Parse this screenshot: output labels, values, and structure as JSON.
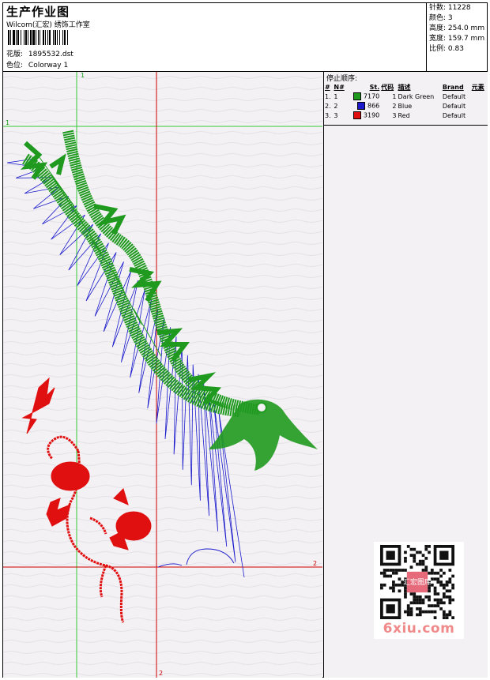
{
  "header": {
    "title": "生产作业图",
    "subtitle": "Wilcom(汇宏) 绣饰工作室",
    "design_label": "花版:",
    "design_value": "1895532.dst",
    "colorway_label": "色位:",
    "colorway_value": "Colorway 1"
  },
  "stats": [
    {
      "label": "针数:",
      "value": "11228"
    },
    {
      "label": "颜色:",
      "value": "3"
    },
    {
      "label": "高度:",
      "value": "254.0 mm"
    },
    {
      "label": "宽度:",
      "value": "159.7 mm"
    },
    {
      "label": "比例:",
      "value": "0.83"
    }
  ],
  "canvas": {
    "guide_markers": [
      "1",
      "1",
      "2",
      "2"
    ],
    "colors": {
      "green": "#1f9a1f",
      "blue": "#1a1acc",
      "red": "#e01010",
      "guide_green": "#33cc33",
      "guide_red": "#cc0000"
    }
  },
  "stop_sequence": {
    "title": "停止顺序:",
    "columns": [
      "#",
      "N#",
      "St.",
      "代码",
      "描述",
      "Brand",
      "元素"
    ],
    "rows": [
      {
        "num": "1.",
        "n": "1",
        "color": "#1f9a1f",
        "stitches": "7170",
        "code": "1",
        "desc": "Dark Green",
        "brand": "Default",
        "elements": ""
      },
      {
        "num": "2.",
        "n": "2",
        "color": "#1a1acc",
        "stitches": "866",
        "code": "2",
        "desc": "Blue",
        "brand": "Default",
        "elements": ""
      },
      {
        "num": "3.",
        "n": "3",
        "color": "#e01010",
        "stitches": "3190",
        "code": "3",
        "desc": "Red",
        "brand": "Default",
        "elements": ""
      }
    ]
  },
  "watermark": "6xiu.com",
  "qr": {
    "center_label": "汇宏图库"
  }
}
